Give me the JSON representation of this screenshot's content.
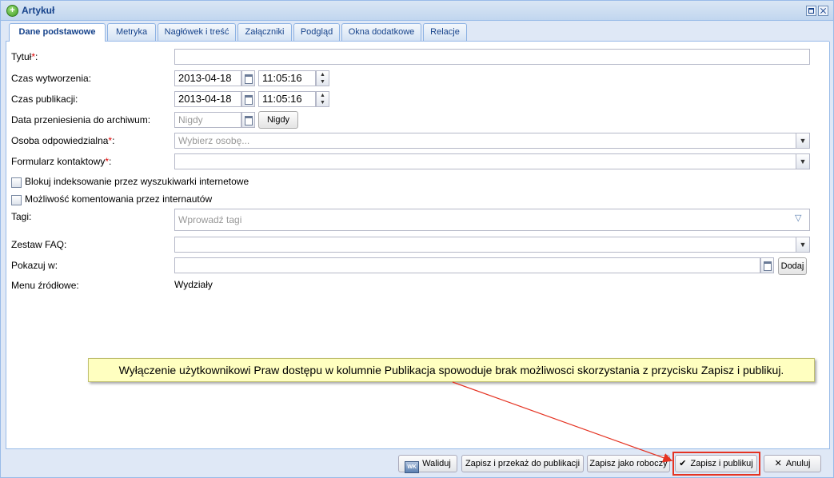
{
  "window": {
    "title": "Artykuł"
  },
  "tabs": [
    {
      "label": "Dane podstawowe",
      "active": true
    },
    {
      "label": "Metryka"
    },
    {
      "label": "Nagłówek i treść"
    },
    {
      "label": "Załączniki"
    },
    {
      "label": "Podgląd"
    },
    {
      "label": "Okna dodatkowe"
    },
    {
      "label": "Relacje"
    }
  ],
  "form": {
    "title": {
      "label": "Tytuł",
      "req": "*",
      "colon": ":",
      "value": ""
    },
    "created": {
      "label": "Czas wytworzenia:",
      "date": "2013-04-18",
      "time": "11:05:16"
    },
    "published": {
      "label": "Czas publikacji:",
      "date": "2013-04-18",
      "time": "11:05:16"
    },
    "archive": {
      "label": "Data przeniesienia do archiwum:",
      "placeholder": "Nigdy",
      "button": "Nigdy"
    },
    "responsible": {
      "label": "Osoba odpowiedzialna",
      "req": "*",
      "colon": ":",
      "placeholder": "Wybierz osobę..."
    },
    "contact_form": {
      "label": "Formularz kontaktowy",
      "req": "*",
      "colon": ":",
      "value": ""
    },
    "block_indexing": {
      "label": "Blokuj indeksowanie przez wyszukiwarki internetowe",
      "checked": false
    },
    "comments": {
      "label": "Możliwość komentowania przez internautów",
      "checked": false
    },
    "tags": {
      "label": "Tagi:",
      "placeholder": "Wprowadź tagi"
    },
    "faq": {
      "label": "Zestaw FAQ:",
      "value": ""
    },
    "show_in": {
      "label": "Pokazuj w:",
      "value": "",
      "button": "Dodaj"
    },
    "source_menu": {
      "label": "Menu źródłowe:",
      "value": "Wydziały"
    }
  },
  "callout": {
    "text": "Wyłączenie użytkownikowi Praw dostępu w kolumnie Publikacja spowoduje brak możliwosci skorzystania z przycisku Zapisz i publikuj."
  },
  "footer": {
    "validate": "Waliduj",
    "validate_icon_text": "WK",
    "save_and_send": "Zapisz i przekaż do publikacji",
    "save_draft": "Zapisz jako roboczy",
    "save_publish": "Zapisz i publikuj",
    "cancel": "Anuluj"
  },
  "colors": {
    "highlight": "#e53322",
    "accent": "#15428b",
    "required": "#dd0000"
  }
}
